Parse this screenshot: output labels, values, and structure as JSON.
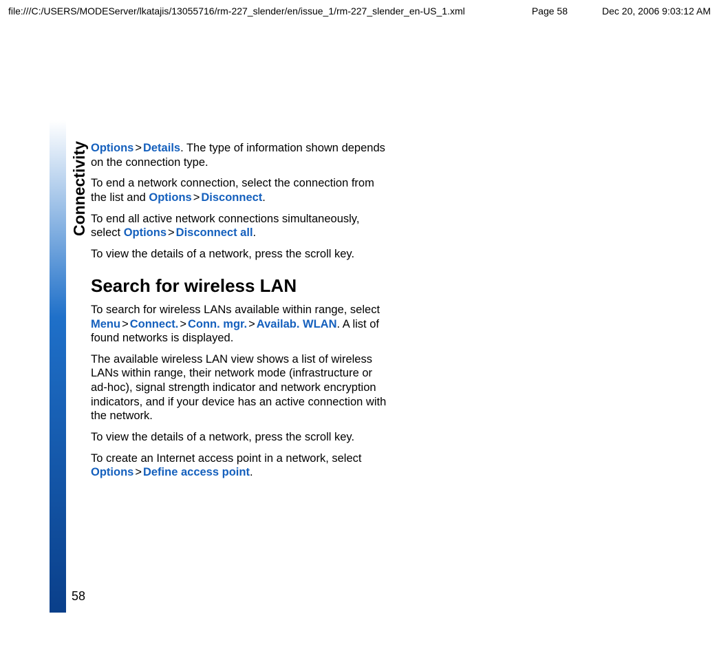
{
  "header": {
    "filepath": "file:///C:/USERS/MODEServer/lkatajis/13055716/rm-227_slender/en/issue_1/rm-227_slender_en-US_1.xml",
    "page_label": "Page 58",
    "timestamp": "Dec 20, 2006 9:03:12 AM"
  },
  "sidebar": {
    "section": "Connectivity"
  },
  "paragraphs": {
    "p1_pre": "",
    "p1_m1": "Options",
    "p1_m2": "Details",
    "p1_post": ". The type of information shown depends on the connection type.",
    "p2_pre": "To end a network connection, select the connection from the list and ",
    "p2_m1": "Options",
    "p2_m2": "Disconnect",
    "p2_post": ".",
    "p3_pre": "To end all active network connections simultaneously, select ",
    "p3_m1": "Options",
    "p3_m2": "Disconnect all",
    "p3_post": ".",
    "p4": "To view the details of a network, press the scroll key.",
    "heading": "Search for wireless LAN",
    "p5_pre": "To search for wireless LANs available within range, select ",
    "p5_m1": "Menu",
    "p5_m2": "Connect.",
    "p5_m3": "Conn. mgr.",
    "p5_m4": "Availab. WLAN",
    "p5_post": ". A list of found networks is displayed.",
    "p6": "The available wireless LAN view shows a list of wireless LANs within range, their network mode (infrastructure or ad-hoc), signal strength indicator and network encryption indicators, and if your device has an active connection with the network.",
    "p7": "To view the details of a network, press the scroll key.",
    "p8_pre": "To create an Internet access point in a network, select ",
    "p8_m1": "Options",
    "p8_m2": "Define access point",
    "p8_post": "."
  },
  "page_number": "58",
  "gt": ">"
}
